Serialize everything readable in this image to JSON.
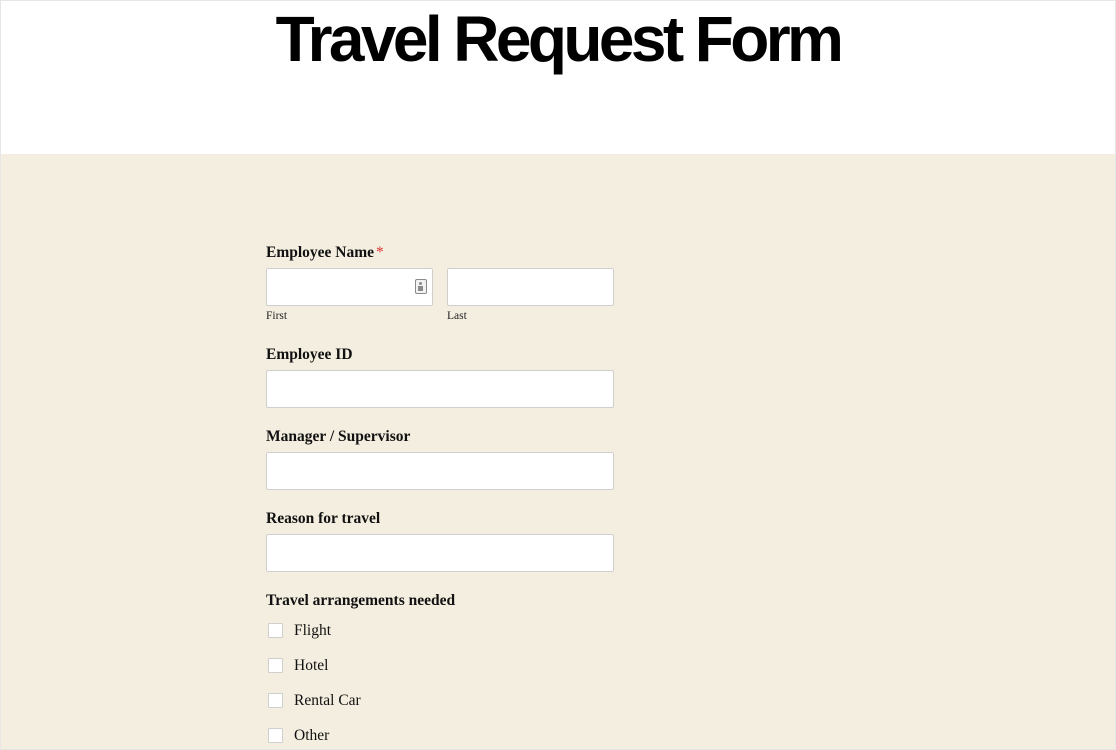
{
  "header": {
    "title": "Travel Request Form"
  },
  "form": {
    "employee_name": {
      "label": "Employee Name",
      "required_marker": "*",
      "first": {
        "value": "",
        "placeholder": "",
        "sublabel": "First"
      },
      "last": {
        "value": "",
        "placeholder": "",
        "sublabel": "Last"
      }
    },
    "employee_id": {
      "label": "Employee ID",
      "value": "",
      "placeholder": ""
    },
    "manager": {
      "label": "Manager / Supervisor",
      "value": "",
      "placeholder": ""
    },
    "reason": {
      "label": "Reason for travel",
      "value": "",
      "placeholder": ""
    },
    "arrangements": {
      "label": "Travel arrangements needed",
      "options": [
        {
          "label": "Flight",
          "checked": false
        },
        {
          "label": "Hotel",
          "checked": false
        },
        {
          "label": "Rental Car",
          "checked": false
        },
        {
          "label": "Other",
          "checked": false
        }
      ]
    }
  },
  "colors": {
    "content_background": "#f4eee0",
    "required": "#d63637",
    "input_border": "#cfcfcf"
  }
}
